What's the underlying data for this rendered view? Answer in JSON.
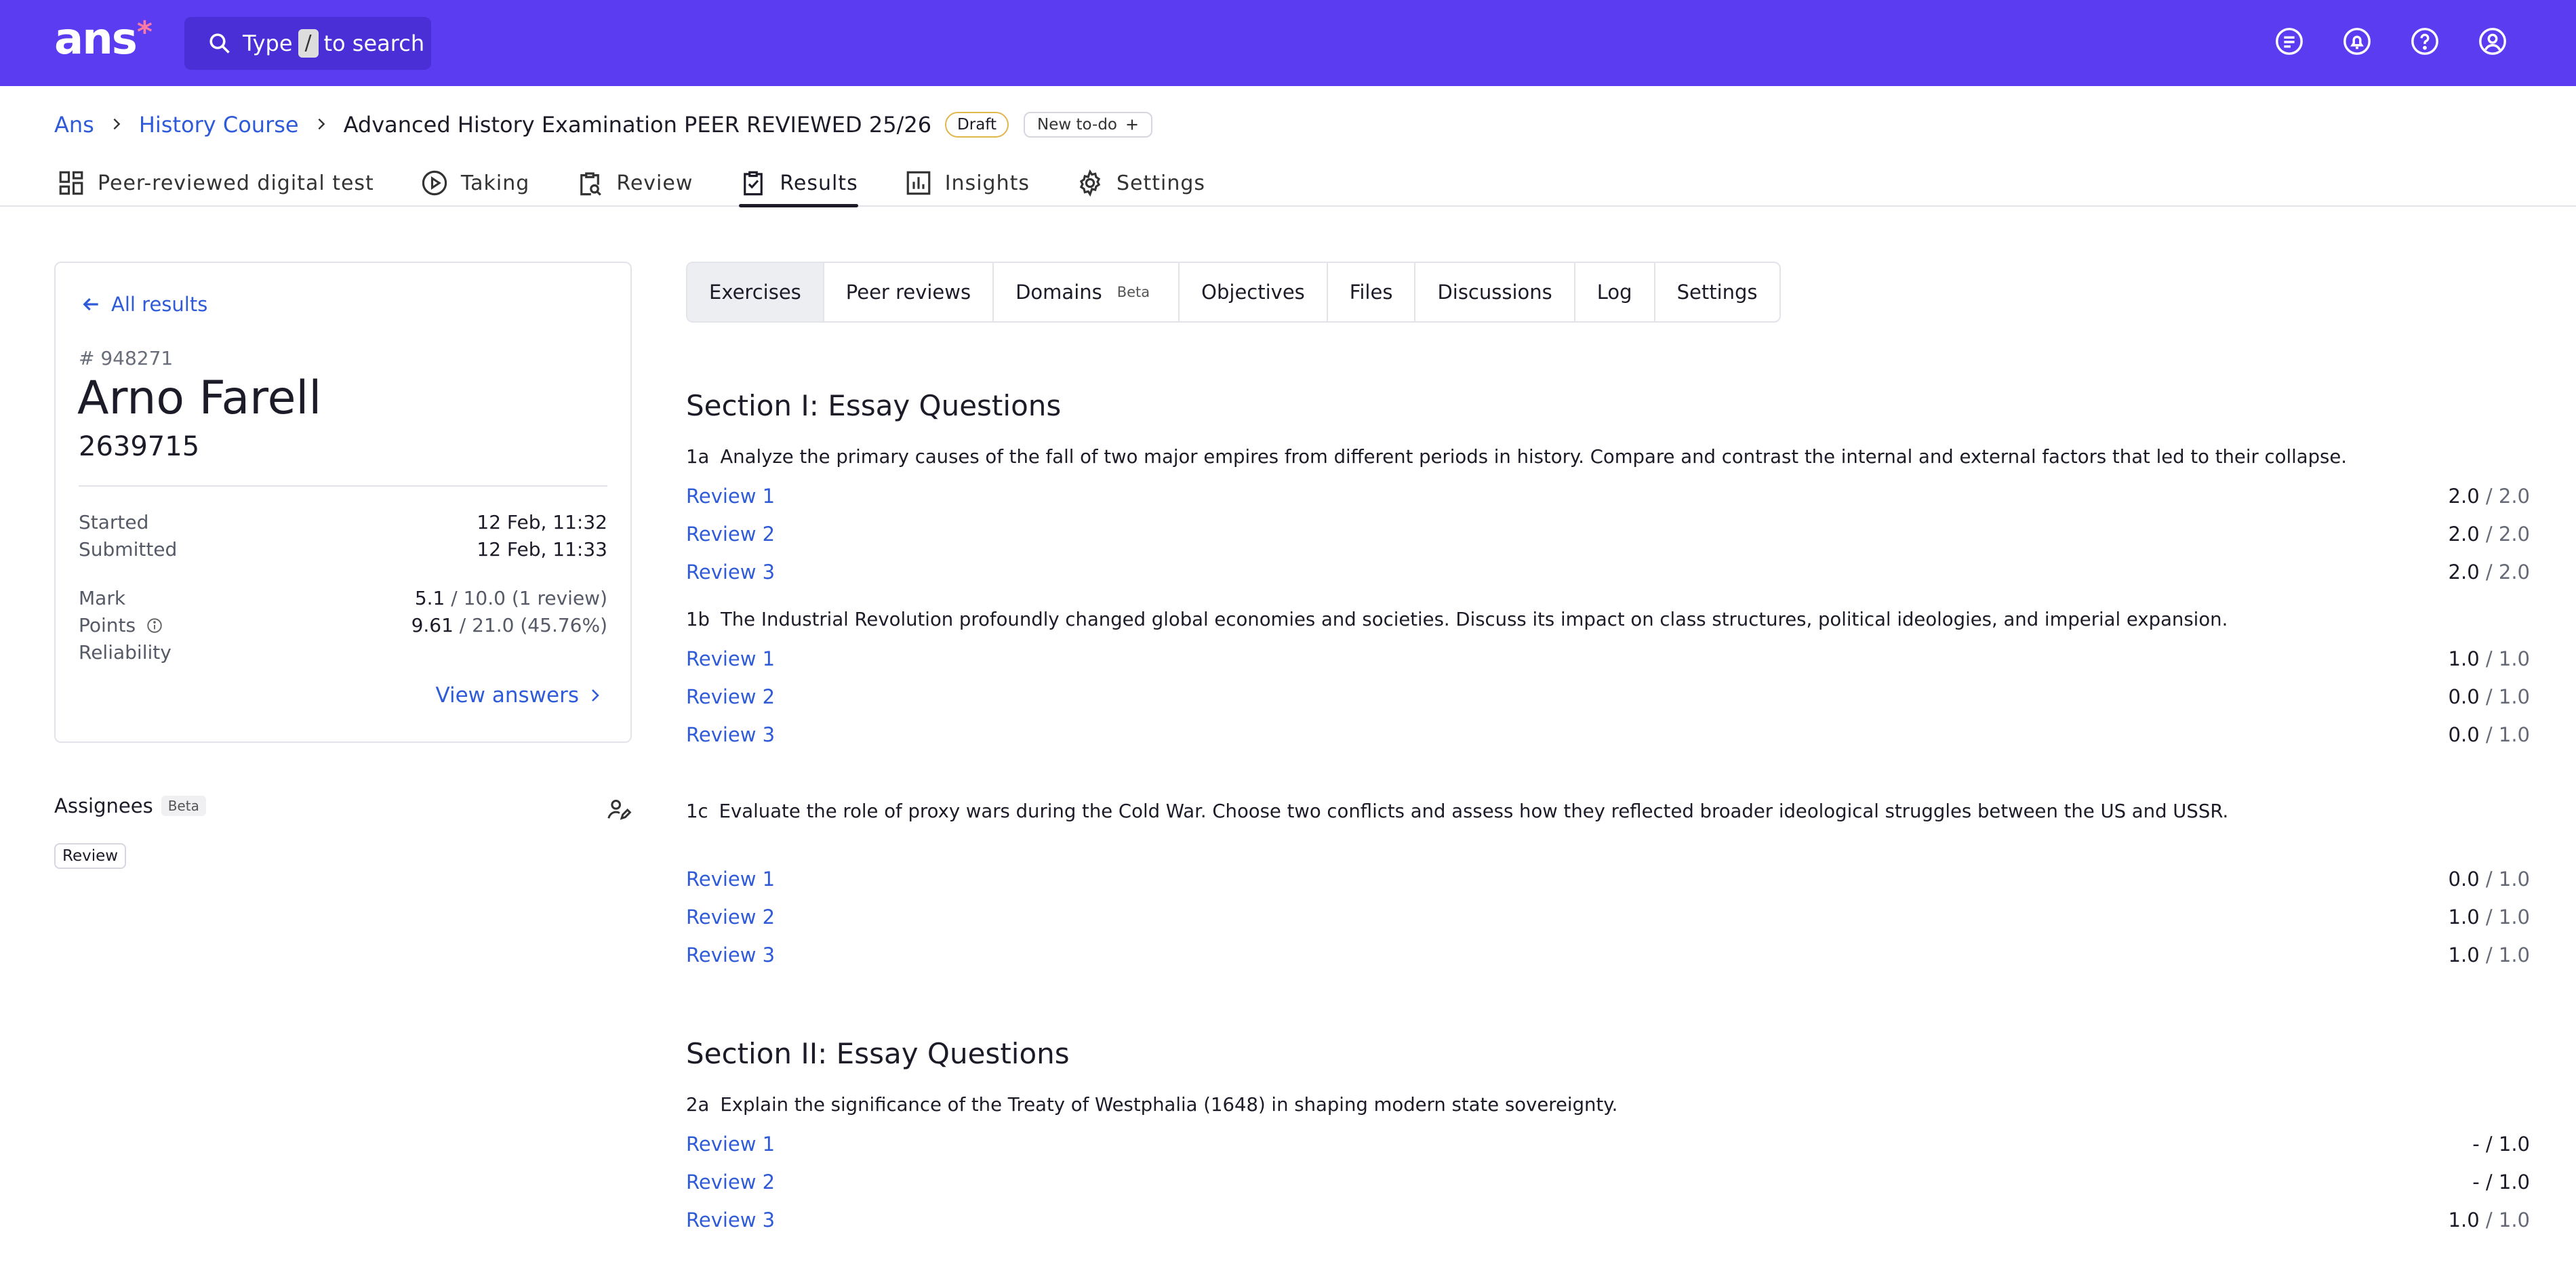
{
  "topbar": {
    "logo": "ans",
    "search": {
      "prefix": "Type",
      "key": "/",
      "suffix": "to search"
    },
    "icons": [
      "task-list-icon",
      "notification-bell-icon",
      "help-icon",
      "user-account-icon"
    ]
  },
  "breadcrumb": {
    "root": "Ans",
    "course": "History Course",
    "current": "Advanced History Examination PEER REVIEWED 25/26",
    "status_badge": "Draft",
    "todo_button": "New to-do"
  },
  "main_tabs": [
    {
      "label": "Peer-reviewed digital test",
      "icon": "dashboard-grid-icon"
    },
    {
      "label": "Taking",
      "icon": "play-circle-icon"
    },
    {
      "label": "Review",
      "icon": "clipboard-search-icon"
    },
    {
      "label": "Results",
      "icon": "clipboard-check-icon",
      "active": true
    },
    {
      "label": "Insights",
      "icon": "bar-chart-icon"
    },
    {
      "label": "Settings",
      "icon": "gear-icon"
    }
  ],
  "student_card": {
    "back_label": "All results",
    "result_id": "# 948271",
    "name": "Arno Farell",
    "student_number": "2639715",
    "started_label": "Started",
    "started_value": "12 Feb, 11:32",
    "submitted_label": "Submitted",
    "submitted_value": "12 Feb, 11:33",
    "mark_label": "Mark",
    "mark_value": "5.1",
    "mark_rest": " / 10.0 (1 review)",
    "points_label": "Points",
    "points_value": "9.61",
    "points_rest": " / 21.0 (45.76%)",
    "reliability_label": "Reliability",
    "view_answers": "View answers"
  },
  "assignees": {
    "label": "Assignees",
    "beta": "Beta",
    "chip": "Review"
  },
  "sub_tabs": [
    {
      "label": "Exercises",
      "active": true
    },
    {
      "label": "Peer reviews"
    },
    {
      "label": "Domains",
      "beta": "Beta"
    },
    {
      "label": "Objectives"
    },
    {
      "label": "Files"
    },
    {
      "label": "Discussions"
    },
    {
      "label": "Log"
    },
    {
      "label": "Settings"
    }
  ],
  "sections": [
    {
      "title": "Section I: Essay Questions",
      "questions": [
        {
          "number": "1a",
          "text": "Analyze the primary causes of the fall of two major empires from different periods in history. Compare and contrast the internal and external factors that led to their collapse.",
          "reviews": [
            {
              "label": "Review 1",
              "score": "2.0",
              "max": " / 2.0"
            },
            {
              "label": "Review 2",
              "score": "2.0",
              "max": " / 2.0"
            },
            {
              "label": "Review 3",
              "score": "2.0",
              "max": " / 2.0"
            }
          ]
        },
        {
          "number": "1b",
          "text": "The Industrial Revolution profoundly changed global economies and societies. Discuss its impact on class structures, political ideologies, and imperial expansion.",
          "reviews": [
            {
              "label": "Review 1",
              "score": "1.0",
              "max": " / 1.0"
            },
            {
              "label": "Review 2",
              "score": "0.0",
              "max": " / 1.0"
            },
            {
              "label": "Review 3",
              "score": "0.0",
              "max": " / 1.0"
            }
          ]
        },
        {
          "number": "1c",
          "text": "Evaluate the role of proxy wars during the Cold War. Choose two conflicts and assess how they reflected broader ideological struggles between the US and USSR.",
          "reviews": [
            {
              "label": "Review 1",
              "score": "0.0",
              "max": " / 1.0"
            },
            {
              "label": "Review 2",
              "score": "1.0",
              "max": " / 1.0"
            },
            {
              "label": "Review 3",
              "score": "1.0",
              "max": " / 1.0"
            }
          ]
        }
      ]
    },
    {
      "title": "Section II: Essay Questions",
      "questions": [
        {
          "number": "2a",
          "text": "Explain the significance of the Treaty of Westphalia (1648) in shaping modern state sovereignty.",
          "reviews": [
            {
              "label": "Review 1",
              "score": "- / 1.0",
              "max": ""
            },
            {
              "label": "Review 2",
              "score": "- / 1.0",
              "max": ""
            },
            {
              "label": "Review 3",
              "score": "1.0",
              "max": " / 1.0"
            }
          ]
        }
      ]
    }
  ],
  "colors": {
    "topbar": "#5b3cf0",
    "link": "#2f5bd8",
    "draft_border": "#e0b64d"
  }
}
